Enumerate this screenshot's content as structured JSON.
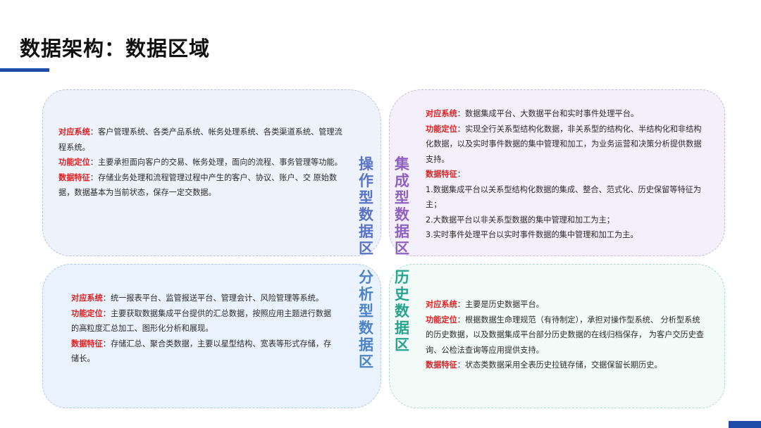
{
  "page": {
    "title": "数据架构：数据区域"
  },
  "quadrants": {
    "operational": {
      "label_chars": [
        "操",
        "作",
        "型",
        "数",
        "据",
        "区"
      ],
      "system_label": "对应系统",
      "system_text": "客户管理系统、各类产品系统、帐务处理系统、各类渠道系统、管理流程系统。",
      "function_label": "功能定位",
      "function_text": "主要承担面向客户的交易、帐务处理，面向的流程、事务管理等功能。",
      "feature_label": "数据特征",
      "feature_text": "存储业务处理和流程管理过程中产生的客户、协议、账户、交 原始数据，数据基本为当前状态，保存一定交数据。"
    },
    "integrated": {
      "label_chars": [
        "集",
        "成",
        "型",
        "数",
        "据",
        "区"
      ],
      "system_label": "对应系统",
      "system_text": "数据集成平台、大数据平台和实时事件处理平台。",
      "function_label": "功能定位",
      "function_text": "实现全行关系型结构化数据，非关系型的结构化、半结构化和非结构化数据，以及实时事件数据的集中管理和加工，为业务运营和决策分析提供数据支持。",
      "feature_label": "数据特征",
      "items": [
        "1.数据集成平台以关系型结构化数据的集成、整合、范式化、历史保留等特征为主；",
        "2.大数据平台以非关系型数据的集中管理和加工为主；",
        "3.实时事件处理平台以实时事件数据的集中管理和加工为主。"
      ]
    },
    "analytical": {
      "label_chars": [
        "分",
        "析",
        "型",
        "数",
        "据",
        "区"
      ],
      "system_label": "对应系统",
      "system_text": "统一报表平台、监管报送平台、管理会计、风险管理等系统。",
      "function_label": "功能定位",
      "function_text": "主要获取数据集成平台提供的汇总数据，按照应用主题进行数据的高粒度汇总加工、图形化分析和展现。",
      "feature_label": "数据特征",
      "feature_text": "存储汇总、聚合类数据，主要以星型结构、宽表等形式存储，存储长。"
    },
    "historical": {
      "label_chars": [
        "历",
        "史",
        "数",
        "据",
        "区"
      ],
      "system_label": "对应系统",
      "system_text": "主要是历史数据平台。",
      "function_label": "功能定位",
      "function_text": "根据数据生命理规范（有待制定），承担对操作型系统、 分析型系统的历史数据，以及数据集成平台部分历史数据的在线归档保存， 为客户交历史查询、公检法查询等应用提供支持。",
      "feature_label": "数据特征",
      "feature_text": "状态类数据采用全表历史拉链存储，交据保留长期历史。"
    }
  }
}
